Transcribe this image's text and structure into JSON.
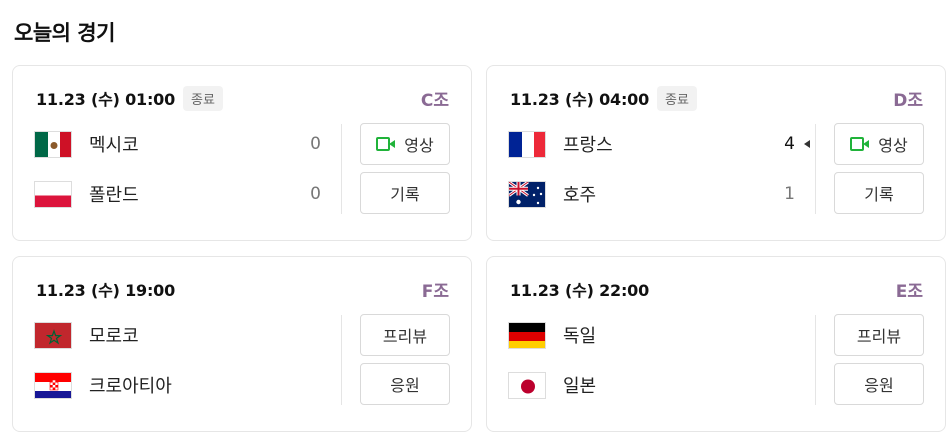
{
  "page_title": "오늘의 경기",
  "matches": [
    {
      "datetime": "11.23 (수) 01:00",
      "status": "종료",
      "group": "C조",
      "home": {
        "name": "멕시코",
        "flag_icon": "mexico-flag-icon",
        "score": "0"
      },
      "away": {
        "name": "폴란드",
        "flag_icon": "poland-flag-icon",
        "score": "0"
      },
      "buttons": [
        "영상",
        "기록"
      ]
    },
    {
      "datetime": "11.23 (수) 04:00",
      "status": "종료",
      "group": "D조",
      "home": {
        "name": "프랑스",
        "flag_icon": "france-flag-icon",
        "score": "4"
      },
      "away": {
        "name": "호주",
        "flag_icon": "australia-flag-icon",
        "score": "1"
      },
      "buttons": [
        "영상",
        "기록"
      ]
    },
    {
      "datetime": "11.23 (수) 19:00",
      "group": "F조",
      "home": {
        "name": "모로코",
        "flag_icon": "morocco-flag-icon"
      },
      "away": {
        "name": "크로아티아",
        "flag_icon": "croatia-flag-icon"
      },
      "buttons": [
        "프리뷰",
        "응원"
      ]
    },
    {
      "datetime": "11.23 (수) 22:00",
      "group": "E조",
      "home": {
        "name": "독일",
        "flag_icon": "germany-flag-icon"
      },
      "away": {
        "name": "일본",
        "flag_icon": "japan-flag-icon"
      },
      "buttons": [
        "프리뷰",
        "응원"
      ]
    }
  ],
  "colors": {
    "group": "#8a6a94",
    "video_icon": "#20b33a",
    "status_bg": "#f2f2f2"
  }
}
